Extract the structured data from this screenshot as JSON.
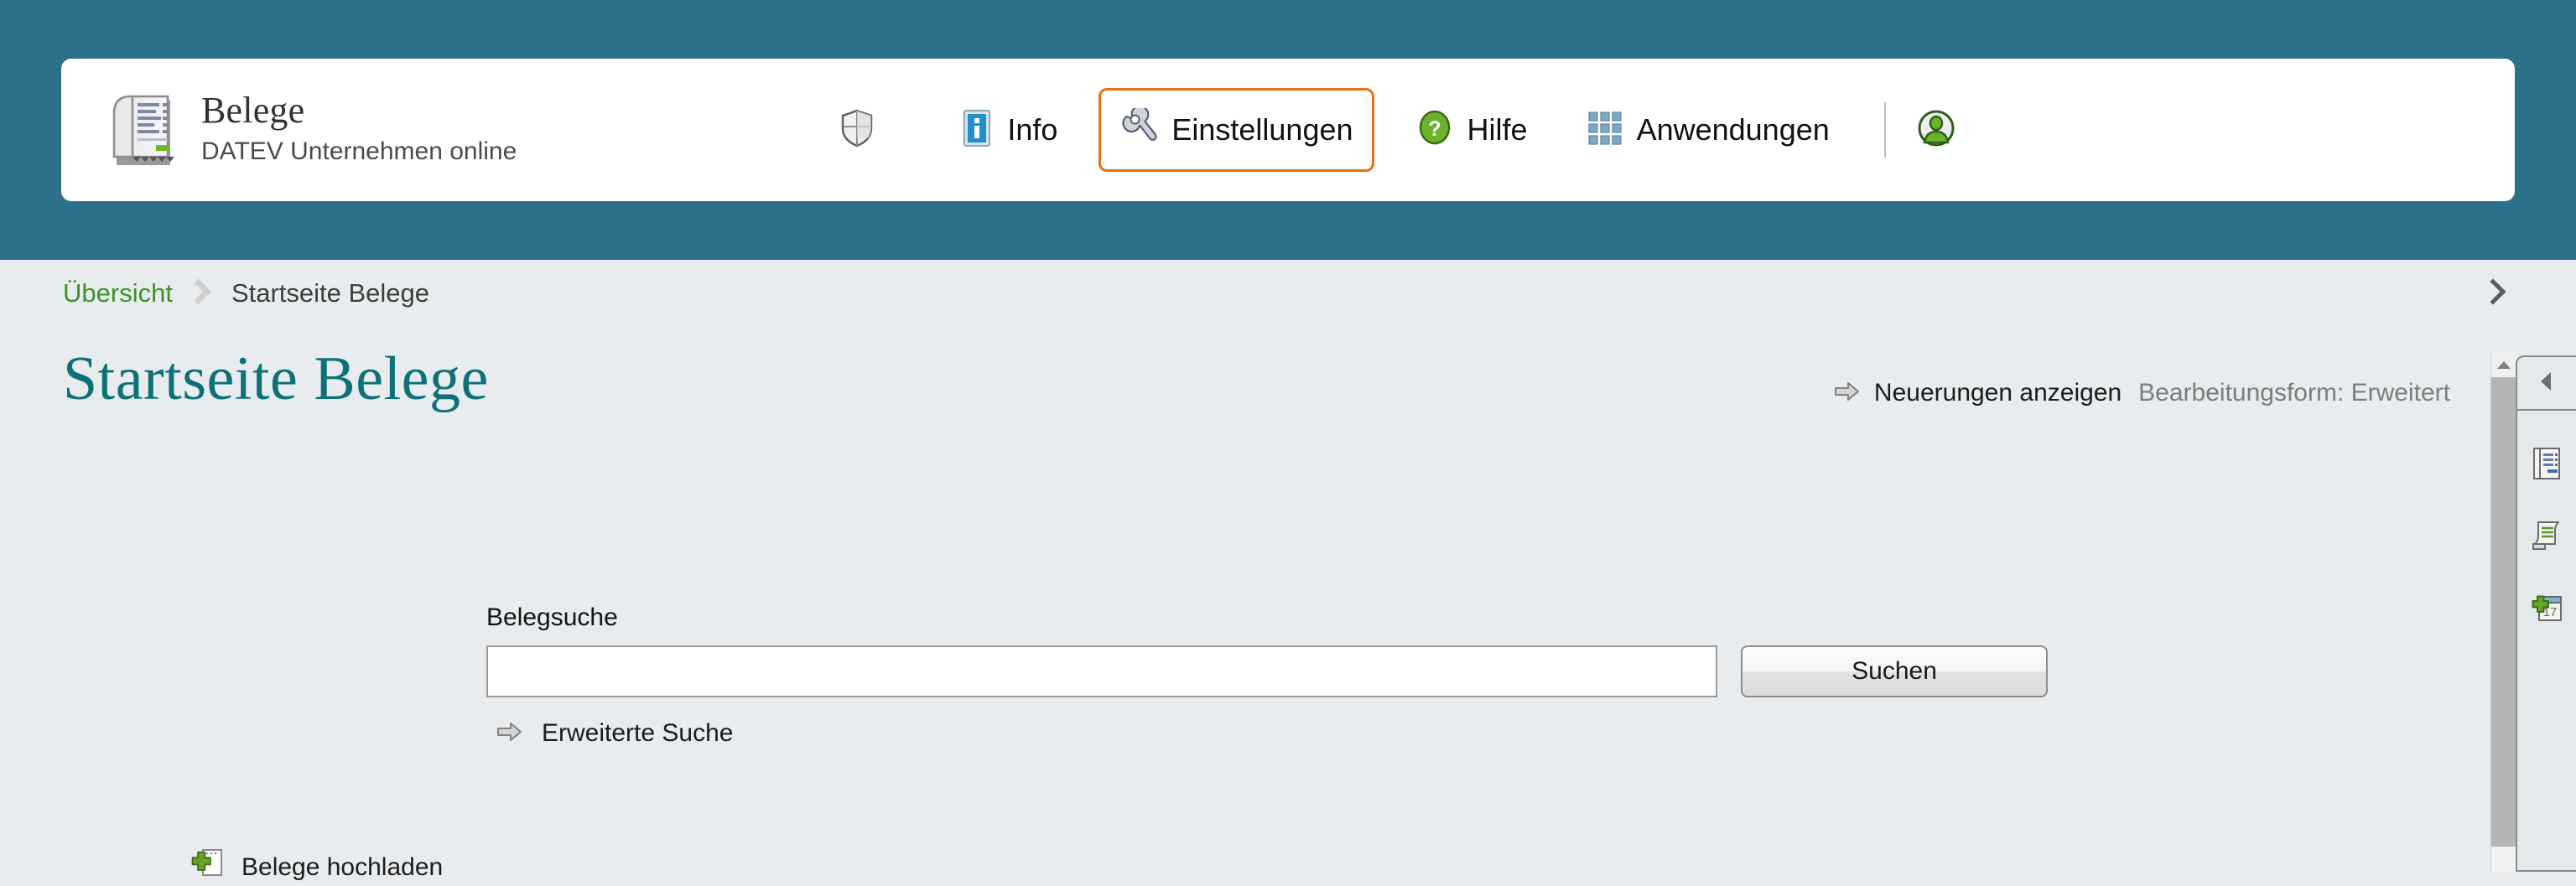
{
  "header": {
    "brand": {
      "icon": "receipt-icon",
      "title": "Belege",
      "subtitle": "DATEV Unternehmen online"
    },
    "nav_items": [
      {
        "icon": "shield-icon",
        "label": "",
        "focused": false
      },
      {
        "icon": "info-icon",
        "label": "Info",
        "focused": false
      },
      {
        "icon": "wrench-icon",
        "label": "Einstellungen",
        "focused": true
      },
      {
        "icon": "help-icon",
        "label": "Hilfe",
        "focused": false
      },
      {
        "icon": "apps-grid-icon",
        "label": "Anwendungen",
        "focused": false
      }
    ],
    "account": {
      "icon": "user-avatar-icon"
    }
  },
  "breadcrumb": {
    "link": "Übersicht",
    "separator_icon": "chevron-right-icon",
    "current": "Startseite Belege",
    "expand_icon": "chevron-right-icon"
  },
  "main": {
    "page_title": "Startseite Belege",
    "news_icon": "arrow-right-icon",
    "news_link": "Neuerungen anzeigen",
    "edit_mode_note": "Bearbeitungsform: Erweitert",
    "search": {
      "label": "Belegsuche",
      "value": "",
      "placeholder": "",
      "button": "Suchen",
      "advanced_icon": "arrow-right-icon",
      "advanced_link": "Erweiterte Suche"
    },
    "bottom_partial": {
      "icon": "add-document-icon",
      "label": "Belege hochladen"
    }
  },
  "scrollbar": {
    "up_icon": "triangle-up-icon"
  },
  "right_panel": {
    "collapse_icon": "triangle-left-icon",
    "items": [
      {
        "icon": "document-list-icon"
      },
      {
        "icon": "scroll-list-icon"
      },
      {
        "icon": "add-calendar-icon"
      }
    ]
  },
  "colors": {
    "header_teal": "#2d7089",
    "body_bg": "#e8ecee",
    "title_teal": "#0d7178",
    "link_green": "#3c9129",
    "focus_orange": "#e8700f"
  }
}
